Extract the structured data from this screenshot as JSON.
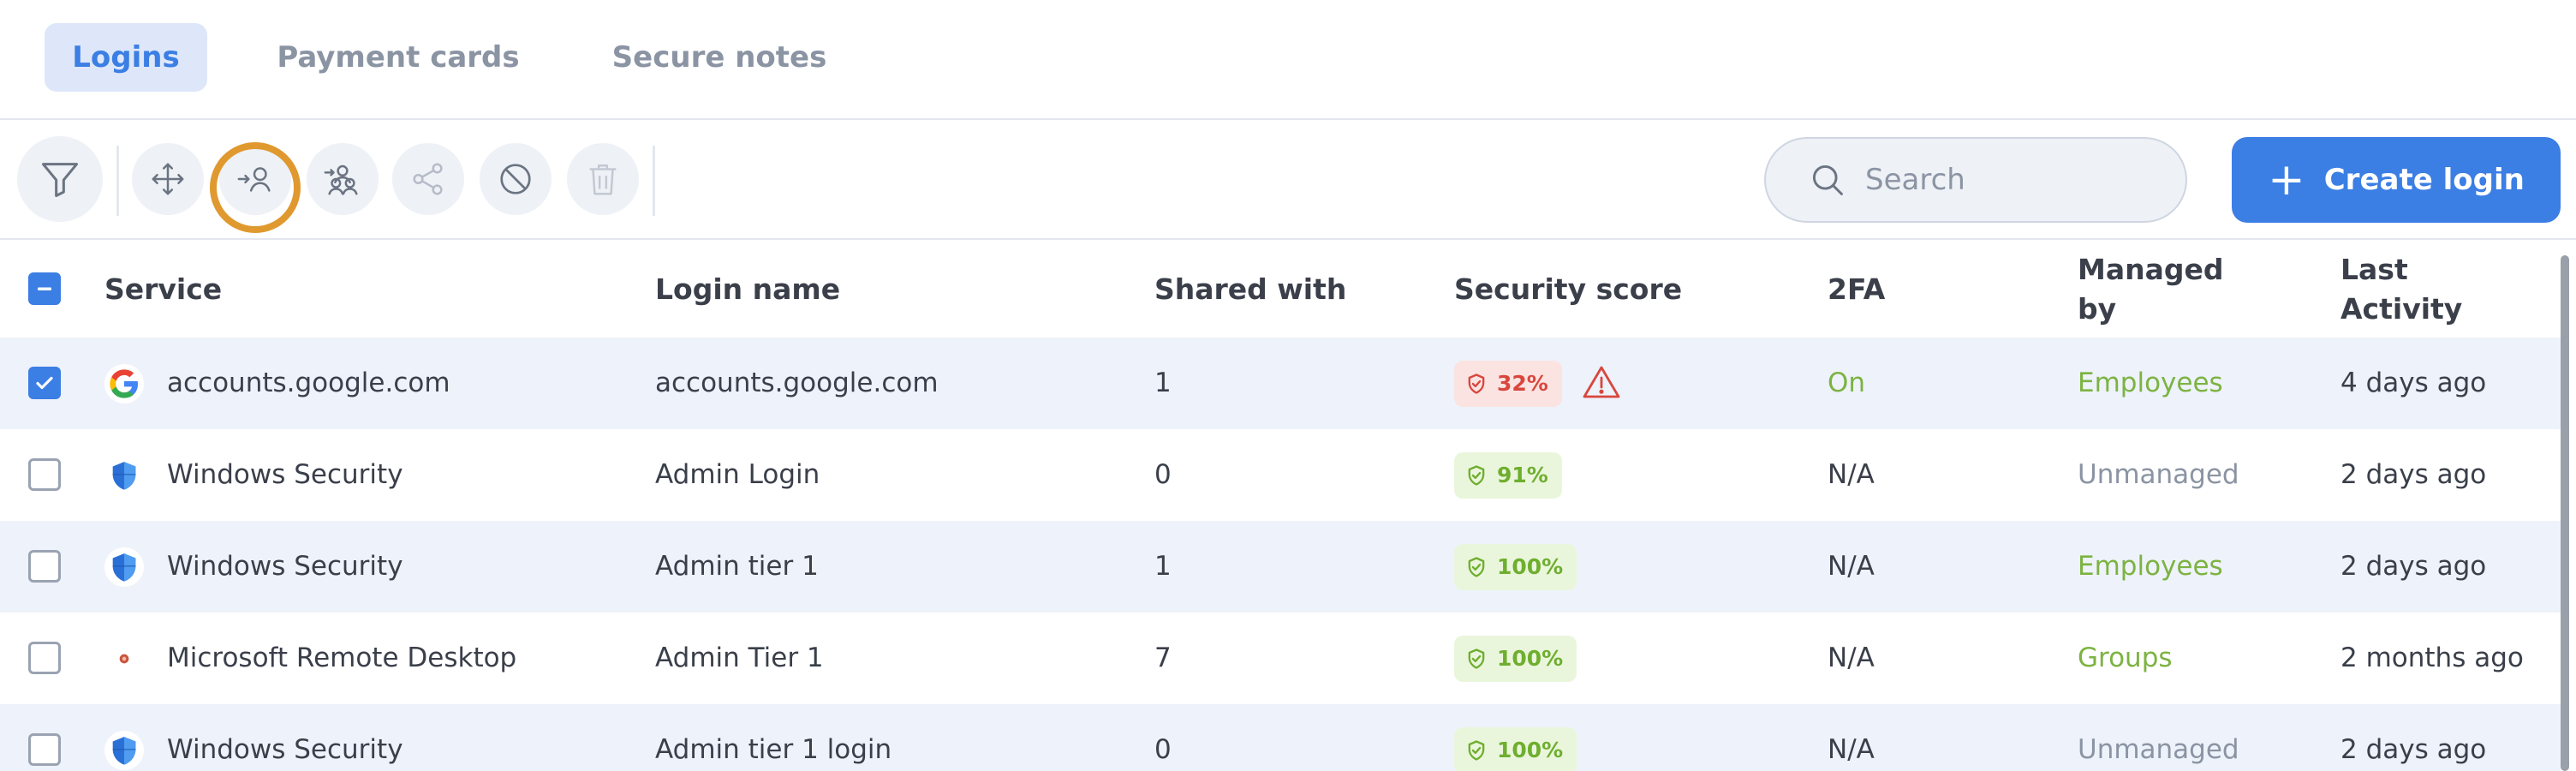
{
  "tabs": [
    {
      "label": "Logins",
      "active": true
    },
    {
      "label": "Payment cards",
      "active": false
    },
    {
      "label": "Secure notes",
      "active": false
    }
  ],
  "toolbar": {
    "icons": [
      "filter-icon",
      "move-icon",
      "assign-user-icon",
      "assign-group-icon",
      "share-icon",
      "block-icon",
      "trash-icon"
    ],
    "search_placeholder": "Search",
    "create_label": "Create login"
  },
  "table": {
    "headers": {
      "service": "Service",
      "login_name": "Login name",
      "shared_with": "Shared with",
      "security_score": "Security score",
      "twofa": "2FA",
      "managed_by": "Managed by",
      "last_activity": "Last Activity"
    },
    "rows": [
      {
        "checked": true,
        "icon": "google-icon",
        "service": "accounts.google.com",
        "login_name": "accounts.google.com",
        "shared_with": "1",
        "score": "32%",
        "score_level": "bad",
        "warning": true,
        "twofa": "On",
        "managed_by": "Employees",
        "last_activity": "4 days ago"
      },
      {
        "checked": false,
        "icon": "windows-security-icon",
        "service": "Windows Security",
        "login_name": "Admin Login",
        "shared_with": "0",
        "score": "91%",
        "score_level": "good",
        "warning": false,
        "twofa": "N/A",
        "managed_by": "Unmanaged",
        "last_activity": "2 days ago"
      },
      {
        "checked": false,
        "icon": "windows-security-icon",
        "service": "Windows Security",
        "login_name": "Admin tier 1",
        "shared_with": "1",
        "score": "100%",
        "score_level": "good",
        "warning": false,
        "twofa": "N/A",
        "managed_by": "Employees",
        "last_activity": "2 days ago"
      },
      {
        "checked": false,
        "icon": "remote-desktop-icon",
        "service": "Microsoft Remote Desktop",
        "login_name": "Admin Tier 1",
        "shared_with": "7",
        "score": "100%",
        "score_level": "good",
        "warning": false,
        "twofa": "N/A",
        "managed_by": "Groups",
        "last_activity": "2 months ago"
      },
      {
        "checked": false,
        "icon": "windows-security-icon",
        "service": "Windows Security",
        "login_name": "Admin tier 1 login",
        "shared_with": "0",
        "score": "100%",
        "score_level": "good",
        "warning": false,
        "twofa": "N/A",
        "managed_by": "Unmanaged",
        "last_activity": "2 days ago"
      }
    ]
  },
  "colors": {
    "accent": "#3b7ee4",
    "highlight_ring": "#e0992f",
    "good": "#6fae2f",
    "bad": "#d8473d",
    "managed_green": "#7cb342"
  }
}
